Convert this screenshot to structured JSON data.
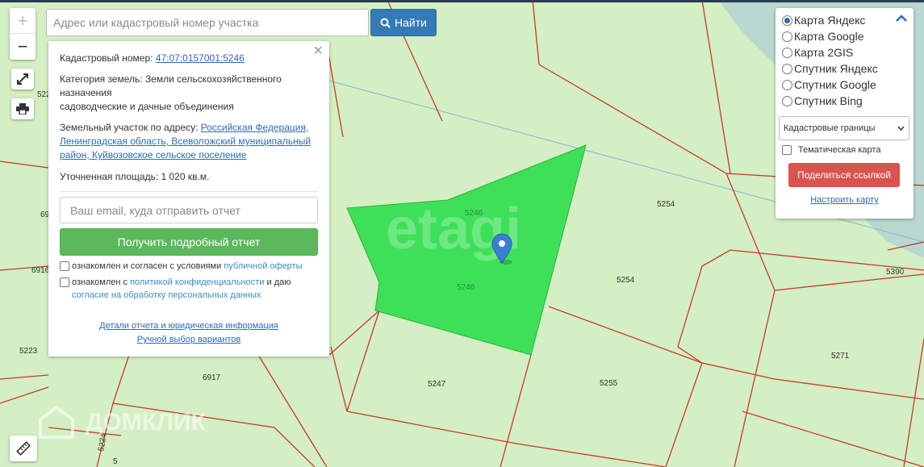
{
  "search": {
    "placeholder": "Адрес или кадастровый номер участка",
    "button_label": "Найти"
  },
  "zoom": {
    "plus": "+",
    "minus": "−"
  },
  "popup": {
    "cadastral_label": "Кадастровый номер:",
    "cadastral_value": "47:07:0157001:5246",
    "category_label": "Категория земель:",
    "category_value": "Земли сельскохозяйственного назначения",
    "category_value2": "садоводческие и дачные объединения",
    "address_label": "Земельный участок по адресу:",
    "address_value": "Российская Федерация, Ленинградская область, Всеволожский муниципальный район, Куйвозовское сельское поселение",
    "area_label": "Уточненная площадь:",
    "area_value": "1 020 кв.м.",
    "email_placeholder": "Ваш email, куда отправить отчет",
    "report_button": "Получить подробный отчет",
    "consent1_text": "ознакомлен и согласен с условиями",
    "consent1_link": "публичной оферты",
    "consent2_text": "ознакомлен с",
    "consent2_link": "политикой конфиденциальности",
    "consent2_tail": "и даю",
    "consent2_link2": "согласие на обработку персональных данных",
    "details_link": "Детали отчета и юридическая информация",
    "manual_link": "Ручной выбор вариантов",
    "close": "×"
  },
  "layers": {
    "options": [
      {
        "label": "Карта Яндекс",
        "selected": true
      },
      {
        "label": "Карта Google",
        "selected": false
      },
      {
        "label": "Карта 2GIS",
        "selected": false
      },
      {
        "label": "Спутник Яндекс",
        "selected": false
      },
      {
        "label": "Спутник Google",
        "selected": false
      },
      {
        "label": "Спутник Bing",
        "selected": false
      }
    ],
    "select_value": "Кадастровые границы",
    "thematic_label": "Тематическая карта",
    "share_button": "Поделиться ссылкой",
    "setup_link": "Настроить карту"
  },
  "map": {
    "parcel_numbers": [
      "5246",
      "5246",
      "5254",
      "5254",
      "5390",
      "5271",
      "5255",
      "5247",
      "6917",
      "5223",
      "6916",
      "69",
      "522",
      "5224",
      "5"
    ],
    "watermark_etagi": "etagi",
    "watermark_domclick": "ДОМКЛИК"
  },
  "colors": {
    "map_bg": "#d4efc4",
    "parcel_line": "#c8392b",
    "selected_parcel": "#3ee05a",
    "water": "#b9d9d0",
    "marker": "#3a7fd5"
  }
}
